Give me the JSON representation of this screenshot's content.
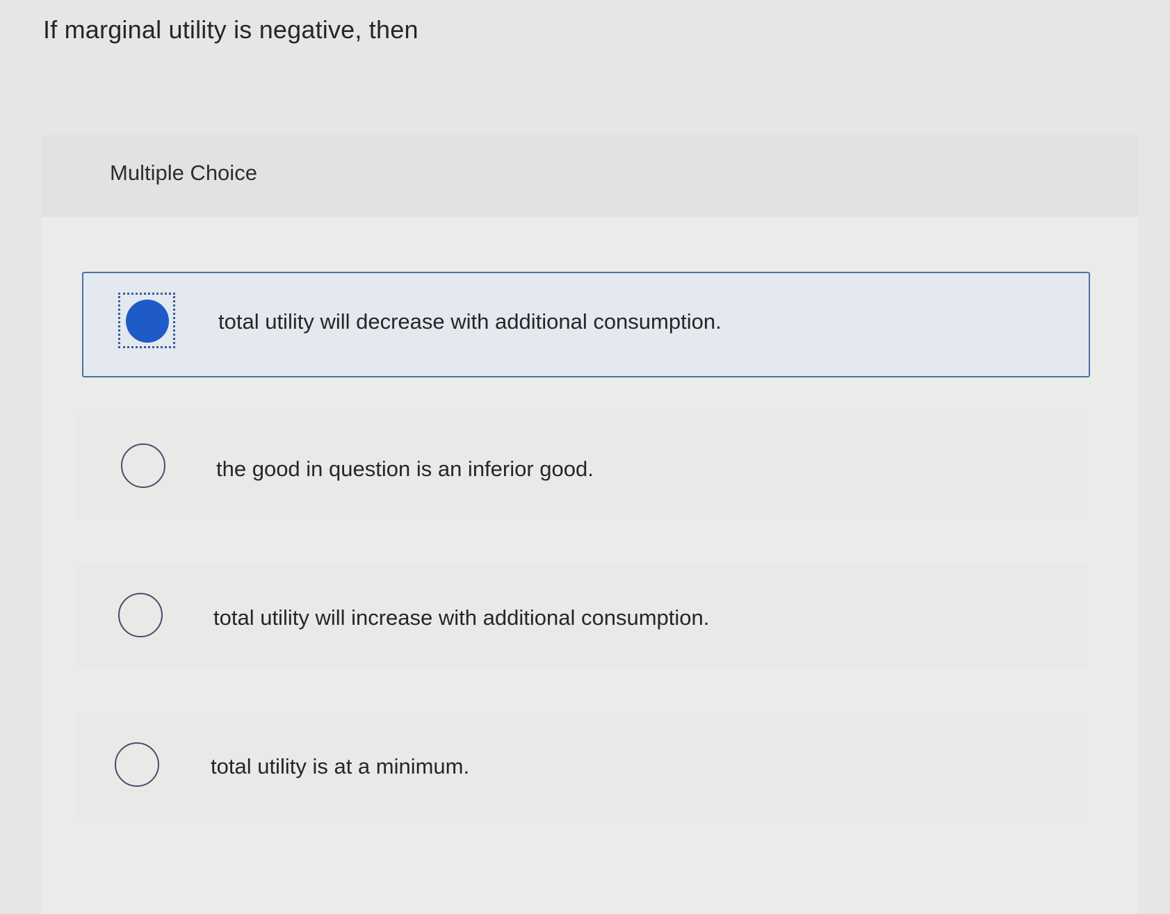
{
  "question": {
    "text": "If marginal utility is negative, then"
  },
  "panel": {
    "title": "Multiple Choice"
  },
  "options": [
    {
      "label": "total utility will decrease with additional consumption.",
      "selected": true
    },
    {
      "label": "the good in question is an inferior good.",
      "selected": false
    },
    {
      "label": "total utility will increase with additional consumption.",
      "selected": false
    },
    {
      "label": "total utility is at a minimum.",
      "selected": false
    }
  ],
  "colors": {
    "selected_fill": "#1f5bc6",
    "selected_border": "#4d6fa8",
    "selected_background": "#e3e9ee"
  }
}
